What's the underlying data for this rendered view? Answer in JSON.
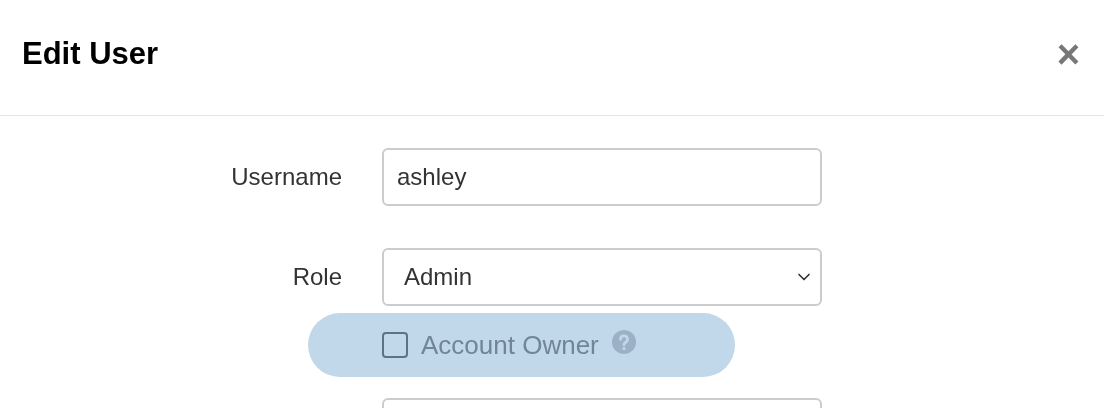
{
  "dialog": {
    "title": "Edit User",
    "close_label": "×"
  },
  "fields": [
    {
      "kind": "text",
      "label": "Username",
      "value": "ashley"
    },
    {
      "kind": "select",
      "label": "Role",
      "value": "Admin"
    }
  ],
  "account_owner": {
    "label": "Account Owner",
    "checked": false,
    "highlighted": true
  }
}
